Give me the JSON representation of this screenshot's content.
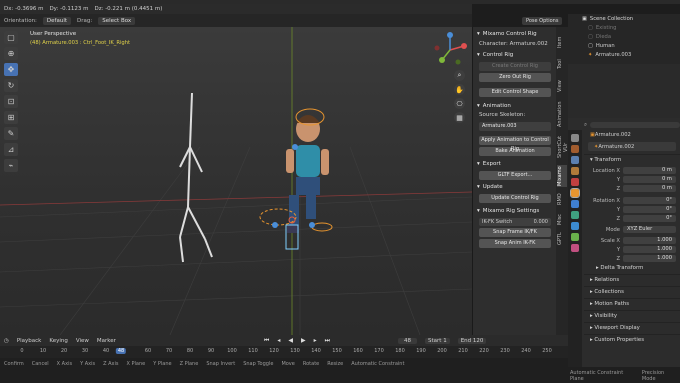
{
  "header": {
    "stats": [
      "Dx: -0.3696 m",
      "Dy: -0.1123 m",
      "Dz: -0.221 m (0.4451 m)"
    ],
    "orientation_label": "Orientation:",
    "orientation_value": "Default",
    "drag_label": "Drag:",
    "drag_value": "Select Box",
    "pose_options": "Pose Options"
  },
  "viewport": {
    "title": "User Perspective",
    "subtitle": "(48) Armature.003 : Ctrl_Foot_IK_Right",
    "tools": [
      "select-icon",
      "cursor-icon",
      "move-icon",
      "rotate-icon",
      "scale-icon",
      "transform-icon",
      "annotate-icon",
      "measure-icon",
      "pose-icon"
    ]
  },
  "npanel": {
    "title": "Mixamo Control Rig",
    "character": "Character: Armature.002",
    "control_rig_header": "Control Rig",
    "create_btn": "Create Control Rig",
    "zero_out_btn": "Zero Out Rig",
    "edit_shape_btn": "Edit Control Shape",
    "animation_header": "Animation",
    "source_label": "Source Skeleton:",
    "source_value": "Armature.003",
    "apply_btn": "Apply Animation to Control Rig",
    "bake_btn": "Bake Animation",
    "export_header": "Export",
    "gltf_btn": "GLTF Export...",
    "update_header": "Update",
    "update_btn": "Update Control Rig",
    "settings_header": "Mixamo Rig Settings",
    "ikfk_label": "IK-FK Switch",
    "ikfk_value": "0.000",
    "snap_frame_btn": "Snap Frame IK/FK",
    "snap_anim_btn": "Snap Anim IK-FK"
  },
  "vtabs": [
    "Item",
    "Tool",
    "View",
    "Animation",
    "ShortCut VUr",
    "Mixamo",
    "RMO",
    "Misc",
    "GPTL"
  ],
  "outliner": {
    "title": "Scene Collection",
    "items": [
      "Existing",
      "Dieda",
      "Human",
      "Armature.003"
    ]
  },
  "properties": {
    "object_name": "Armature.002",
    "data_name": "Armature.002",
    "transform_header": "Transform",
    "location_label": "Location X",
    "location": [
      "0 m",
      "0 m",
      "0 m"
    ],
    "rotation_label": "Rotation X",
    "rotation": [
      "0°",
      "0°",
      "0°"
    ],
    "mode_label": "Mode",
    "mode_value": "XYZ Euler",
    "scale_label": "Scale X",
    "scale": [
      "1.000",
      "1.000",
      "1.000"
    ],
    "axis_y": "Y",
    "axis_z": "Z",
    "sections": [
      "Delta Transform",
      "Relations",
      "Collections",
      "Motion Paths",
      "Visibility",
      "Viewport Display",
      "Custom Properties"
    ]
  },
  "timeline": {
    "menu": [
      "Playback",
      "Keying",
      "View",
      "Marker"
    ],
    "current_frame": "48",
    "start_label": "Start",
    "start_value": "1",
    "end_label": "End",
    "end_value": "120",
    "ticks": [
      "0",
      "10",
      "20",
      "30",
      "40",
      "48",
      "60",
      "70",
      "80",
      "90",
      "100",
      "110",
      "120",
      "130",
      "140",
      "150",
      "160",
      "170",
      "180",
      "190",
      "200",
      "210",
      "220",
      "230",
      "240",
      "250"
    ]
  },
  "statusbar": {
    "items": [
      "Confirm",
      "Cancel",
      "X Axis",
      "Y Axis",
      "Z Axis",
      "X Plane",
      "Y Plane",
      "Z Plane",
      "Snap Invert",
      "Snap Toggle",
      "Move",
      "Rotate",
      "Resize",
      "Automatic Constraint",
      "Automatic Constraint Plane",
      "Precision Mode"
    ]
  },
  "colors": {
    "accent": "#4772b3",
    "subtitle": "#e2d34a",
    "selected_bone": "#e8952f"
  }
}
